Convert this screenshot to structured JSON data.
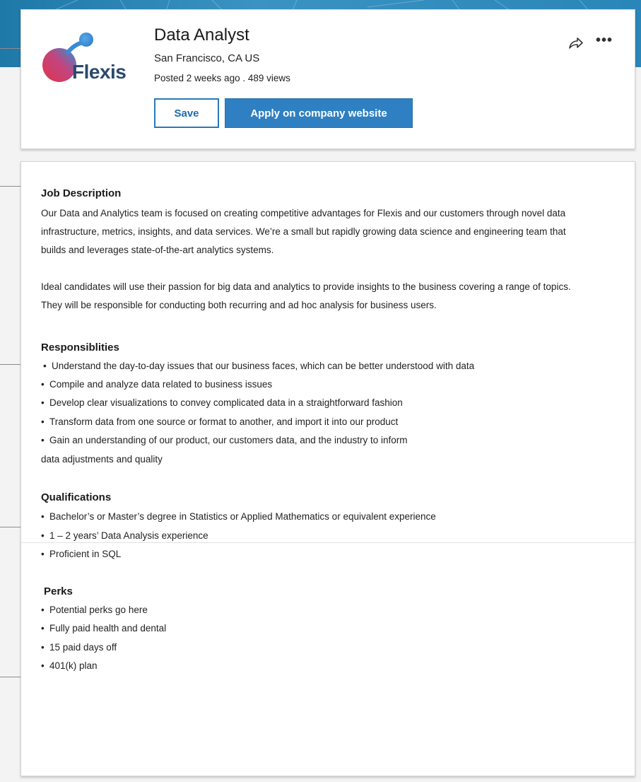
{
  "header": {
    "company_name": "Flexis",
    "job_title": "Data Analyst",
    "location": "San Francisco, CA US",
    "meta": "Posted 2 weeks ago . 489 views",
    "save_label": "Save",
    "apply_label": "Apply on company website",
    "share_icon": "share-icon",
    "more_icon": "more-icon",
    "more_glyph": "•••"
  },
  "description": {
    "title": "Job Description",
    "paragraphs": [
      "Our Data and Analytics team is focused on creating competitive advantages for Flexis and our customers through novel data infrastructure, metrics, insights, and data services. We’re a small but rapidly growing data science and engineering team that builds and leverages state-of-the-art analytics systems.",
      "Ideal candidates will use their passion for big data and analytics to provide insights to the business covering a range of topics. They will be responsible for conducting both recurring and ad hoc analysis for business users."
    ]
  },
  "responsibilities": {
    "title": "Responsiblities",
    "items": [
      "Understand the day-to-day issues that our business faces, which can be better understood with data",
      "Compile and analyze data related to business issues",
      "Develop clear visualizations to convey complicated data in a straightforward fashion",
      "Transform data from one source or format to another, and import it into our product",
      "Gain an understanding of our product, our customers data, and the industry to inform"
    ],
    "continuation": "data adjustments and quality"
  },
  "qualifications": {
    "title": "Qualifications",
    "items": [
      "Bachelor’s or Master’s degree in Statistics or Applied Mathematics or equivalent experience",
      "1 – 2 years’  Data Analysis experience",
      "Proficient in SQL"
    ]
  },
  "perks": {
    "title": "Perks",
    "items": [
      "Potential perks go here",
      "Fully paid health and dental",
      "15 paid days off",
      "401(k) plan"
    ]
  },
  "colors": {
    "primary_button": "#2f80c2",
    "banner": "#2a86b8",
    "logo_gradient_start": "#e0344f",
    "logo_gradient_end": "#2f8fd8"
  }
}
